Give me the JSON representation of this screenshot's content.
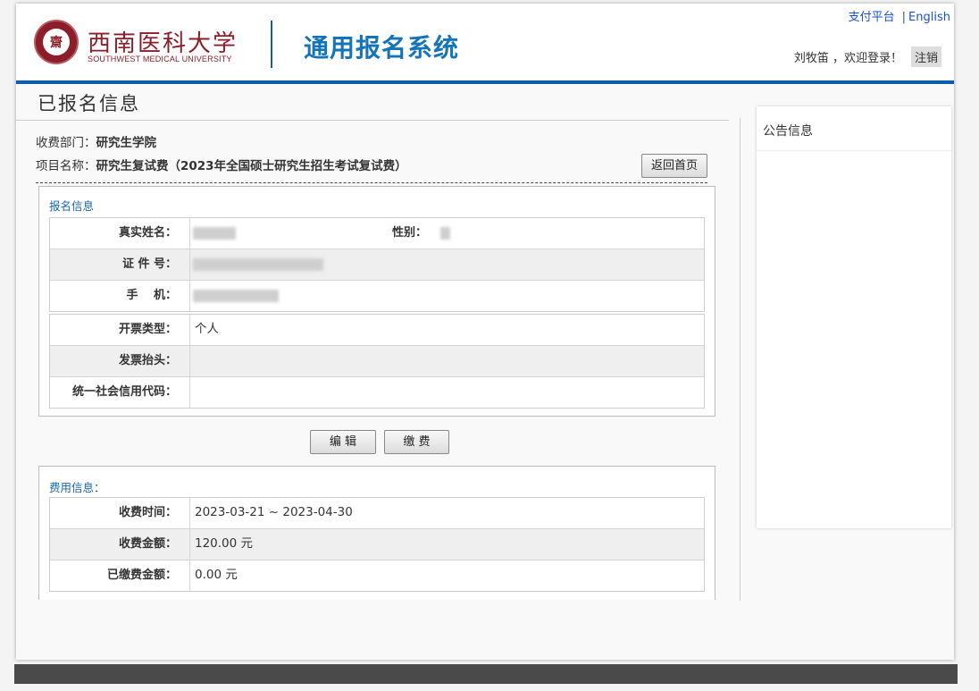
{
  "header": {
    "logo_cn": "西南医科大学",
    "logo_en": "SOUTHWEST MEDICAL UNIVERSITY",
    "system_title": "通用报名系统",
    "links": {
      "pay_platform": "支付平台",
      "separator": "|",
      "english": "English"
    },
    "user_greeting": "刘牧笛 ，欢迎登录！",
    "logout": "注销"
  },
  "main": {
    "section_title": "已报名信息",
    "dept_label": "收费部门：",
    "dept_value": "研究生学院",
    "project_label": "项目名称：",
    "project_value": "研究生复试费（2023年全国硕士研究生招生考试复试费）",
    "back_button": "返回首页"
  },
  "registration": {
    "title": "报名信息",
    "name_label": "真实姓名：",
    "gender_label": "性别：",
    "id_label": "证 件 号：",
    "phone_label": "手　 机：",
    "invoice_type_label": "开票类型：",
    "invoice_type_value": "个人",
    "invoice_title_label": "发票抬头：",
    "invoice_title_value": "",
    "credit_code_label": "统一社会信用代码：",
    "credit_code_value": ""
  },
  "actions": {
    "edit": "编 辑",
    "pay": "缴 费"
  },
  "fees": {
    "title": "费用信息：",
    "time_label": "收费时间：",
    "time_value": "2023-03-21 ~ 2023-04-30",
    "amount_label": "收费金额：",
    "amount_value": "120.00 元",
    "paid_label": "已缴费金额：",
    "paid_value": "0.00 元"
  },
  "notice": {
    "title": "公告信息"
  },
  "colors": {
    "accent": "#1474b8",
    "brand": "#8b1e28",
    "link": "#1a4fd1"
  }
}
